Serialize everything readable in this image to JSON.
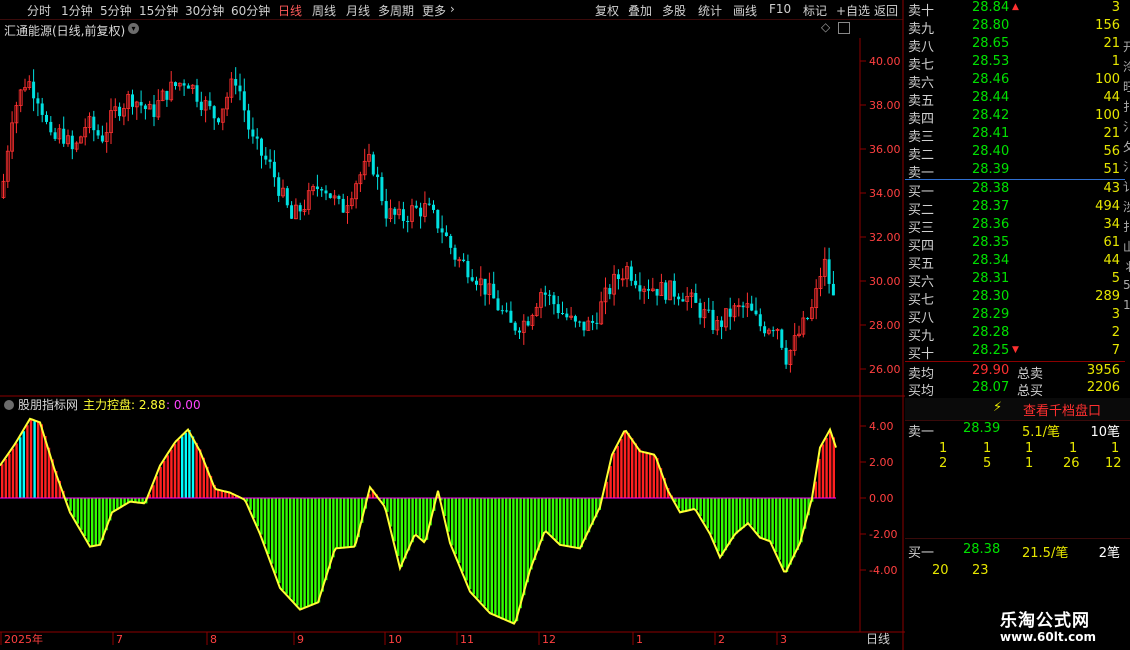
{
  "toolbar": {
    "periods": [
      "分时",
      "1分钟",
      "5分钟",
      "15分钟",
      "30分钟",
      "60分钟",
      "日线",
      "周线",
      "月线",
      "多周期",
      "更多"
    ],
    "active": "日线",
    "tools": [
      "复权",
      "叠加",
      "多股",
      "统计",
      "画线",
      "F10",
      "标记",
      "+自选",
      "返回"
    ]
  },
  "chart": {
    "title": "汇通能源(日线,前复权)",
    "y_ticks": [
      "40.00",
      "38.00",
      "36.00",
      "34.00",
      "32.00",
      "30.00",
      "28.00",
      "26.00"
    ],
    "y_values": [
      40,
      38,
      36,
      34,
      32,
      30,
      28,
      26
    ],
    "x_labels": [
      "2025年",
      "7",
      "8",
      "9",
      "10",
      "11",
      "12",
      "1",
      "2",
      "3"
    ],
    "period_label": "日线"
  },
  "indicator": {
    "name": "股朋指标网",
    "series_label": "主力控盘: 2.88",
    "extra_value": ": 0.00",
    "y_ticks": [
      "4.00",
      "2.00",
      "0.00",
      "-2.00",
      "-4.00"
    ],
    "y_values": [
      4,
      2,
      0,
      -2,
      -4
    ]
  },
  "orderbook": {
    "asks": [
      {
        "label": "卖十",
        "price": "28.84",
        "vol": "3"
      },
      {
        "label": "卖九",
        "price": "28.80",
        "vol": "156"
      },
      {
        "label": "卖八",
        "price": "28.65",
        "vol": "21"
      },
      {
        "label": "卖七",
        "price": "28.53",
        "vol": "1"
      },
      {
        "label": "卖六",
        "price": "28.46",
        "vol": "100"
      },
      {
        "label": "卖五",
        "price": "28.44",
        "vol": "44"
      },
      {
        "label": "卖四",
        "price": "28.42",
        "vol": "100"
      },
      {
        "label": "卖三",
        "price": "28.41",
        "vol": "21"
      },
      {
        "label": "卖二",
        "price": "28.40",
        "vol": "56"
      },
      {
        "label": "卖一",
        "price": "28.39",
        "vol": "51"
      }
    ],
    "bids": [
      {
        "label": "买一",
        "price": "28.38",
        "vol": "43"
      },
      {
        "label": "买二",
        "price": "28.37",
        "vol": "494"
      },
      {
        "label": "买三",
        "price": "28.36",
        "vol": "34"
      },
      {
        "label": "买四",
        "price": "28.35",
        "vol": "61"
      },
      {
        "label": "买五",
        "price": "28.34",
        "vol": "44"
      },
      {
        "label": "买六",
        "price": "28.31",
        "vol": "5"
      },
      {
        "label": "买七",
        "price": "28.30",
        "vol": "289"
      },
      {
        "label": "买八",
        "price": "28.29",
        "vol": "3"
      },
      {
        "label": "买九",
        "price": "28.28",
        "vol": "2"
      },
      {
        "label": "买十",
        "price": "28.25",
        "vol": "7"
      }
    ],
    "sell_avg_label": "卖均",
    "sell_avg": "29.90",
    "sell_total_label": "总卖",
    "sell_total": "3956",
    "buy_avg_label": "买均",
    "buy_avg": "28.07",
    "buy_total_label": "总买",
    "buy_total": "2206"
  },
  "queue": {
    "button_label": "查看千档盘口",
    "sell1": {
      "label": "卖一",
      "price": "28.39",
      "per": "5.1/笔",
      "count": "10笔"
    },
    "sell1_row1": [
      "1",
      "1",
      "1",
      "1",
      "1"
    ],
    "sell1_row2": [
      "2",
      "5",
      "1",
      "26",
      "12"
    ],
    "buy1": {
      "label": "买一",
      "price": "28.38",
      "per": "21.5/笔",
      "count": "2笔"
    },
    "buy1_row1": [
      "20",
      "23"
    ]
  },
  "side_chars": [
    "开",
    "泠",
    "旺",
    "扌",
    "氵",
    "夂",
    "氵",
    "讠",
    "涉",
    "扌",
    "山",
    "丬",
    "5",
    "1"
  ],
  "watermark": {
    "line1": "乐淘公式网",
    "line2": "www.60lt.com"
  },
  "colors": {
    "up": "#ff3030",
    "down": "#00e0e0",
    "macd_pos": "#ff2020",
    "macd_neg": "#33ff00",
    "line": "#ffff33",
    "axis": "#8b0000"
  }
}
